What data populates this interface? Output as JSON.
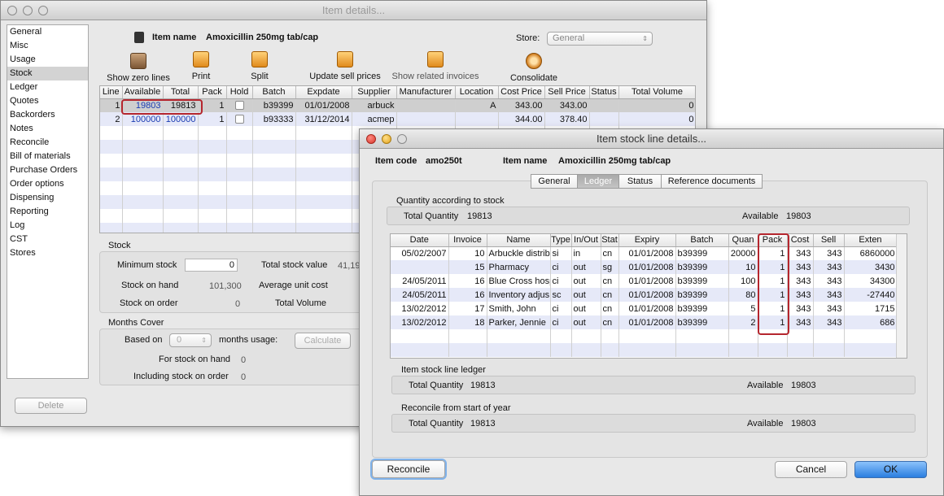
{
  "back_window": {
    "title": "Item details...",
    "sidebar": [
      "General",
      "Misc",
      "Usage",
      "Stock",
      "Ledger",
      "Quotes",
      "Backorders",
      "Notes",
      "Reconcile",
      "Bill of materials",
      "Purchase Orders",
      "Order options",
      "Dispensing",
      "Reporting",
      "Log",
      "CST",
      "Stores"
    ],
    "sidebar_selected": "Stock",
    "delete_label": "Delete",
    "item_name_label": "Item name",
    "item_name": "Amoxicillin 250mg tab/cap",
    "store_label": "Store:",
    "store_value": "General",
    "toolbar": {
      "show_zero": "Show zero lines",
      "print": "Print",
      "split": "Split",
      "update_sell": "Update sell prices",
      "show_related": "Show related invoices",
      "consolidate": "Consolidate"
    },
    "columns": [
      "Line",
      "Available",
      "Total",
      "Pack",
      "Hold",
      "Batch",
      "Expdate",
      "Supplier",
      "Manufacturer",
      "Location",
      "Cost Price",
      "Sell Price",
      "Status",
      "Total Volume"
    ],
    "rows": [
      {
        "line": "1",
        "available": "19803",
        "total": "19813",
        "pack": "1",
        "batch": "b39399",
        "expdate": "01/01/2008",
        "supplier": "arbuck",
        "manufacturer": "",
        "location": "A",
        "cost": "343.00",
        "sell": "343.00",
        "status": "",
        "volume": "0"
      },
      {
        "line": "2",
        "available": "100000",
        "total": "100000",
        "pack": "1",
        "batch": "b93333",
        "expdate": "31/12/2014",
        "supplier": "acmep",
        "manufacturer": "",
        "location": "",
        "cost": "344.00",
        "sell": "378.40",
        "status": "",
        "volume": "0"
      }
    ],
    "stock_section": "Stock",
    "min_stock_label": "Minimum stock",
    "min_stock_value": "0",
    "total_stock_value_label": "Total stock value",
    "total_stock_value": "41,19",
    "stock_on_hand_label": "Stock on hand",
    "stock_on_hand": "101,300",
    "avg_unit_cost_label": "Average unit cost",
    "stock_on_order_label": "Stock on order",
    "stock_on_order": "0",
    "total_volume_label": "Total Volume",
    "months_cover_section": "Months Cover",
    "based_on_label": "Based on",
    "based_on_value": "0",
    "months_usage_label": "months usage:",
    "calculate_label": "Calculate",
    "for_stock_on_hand_label": "For stock on hand",
    "for_stock_on_hand": "0",
    "incl_stock_on_order_label": "Including stock on order",
    "incl_stock_on_order": "0"
  },
  "front_window": {
    "title": "Item stock line details...",
    "item_code_label": "Item code",
    "item_code": "amo250t",
    "item_name_label": "Item name",
    "item_name": "Amoxicillin 250mg tab/cap",
    "tabs": [
      "General",
      "Ledger",
      "Status",
      "Reference documents"
    ],
    "selected_tab": "Ledger",
    "qty_section": "Quantity according to stock",
    "total_quantity_label": "Total Quantity",
    "total_quantity": "19813",
    "available_label": "Available",
    "available": "19803",
    "columns": [
      "Date",
      "Invoice",
      "Name",
      "Type",
      "In/Out",
      "Stat",
      "Expiry",
      "Batch",
      "Quan",
      "Pack",
      "Cost",
      "Sell",
      "Exten"
    ],
    "rows": [
      {
        "date": "05/02/2007",
        "invoice": "10",
        "name": "Arbuckle distrib",
        "type": "si",
        "inout": "in",
        "stat": "cn",
        "expiry": "01/01/2008",
        "batch": "b39399",
        "quan": "20000",
        "pack": "1",
        "cost": "343",
        "sell": "343",
        "exten": "6860000"
      },
      {
        "date": "",
        "invoice": "15",
        "name": "Pharmacy",
        "type": "ci",
        "inout": "out",
        "stat": "sg",
        "expiry": "01/01/2008",
        "batch": "b39399",
        "quan": "10",
        "pack": "1",
        "cost": "343",
        "sell": "343",
        "exten": "3430"
      },
      {
        "date": "24/05/2011",
        "invoice": "16",
        "name": "Blue Cross hosp",
        "type": "ci",
        "inout": "out",
        "stat": "cn",
        "expiry": "01/01/2008",
        "batch": "b39399",
        "quan": "100",
        "pack": "1",
        "cost": "343",
        "sell": "343",
        "exten": "34300"
      },
      {
        "date": "24/05/2011",
        "invoice": "16",
        "name": "Inventory adjus",
        "type": "sc",
        "inout": "out",
        "stat": "cn",
        "expiry": "01/01/2008",
        "batch": "b39399",
        "quan": "80",
        "pack": "1",
        "cost": "343",
        "sell": "343",
        "exten": "-27440"
      },
      {
        "date": "13/02/2012",
        "invoice": "17",
        "name": "Smith, John",
        "type": "ci",
        "inout": "out",
        "stat": "cn",
        "expiry": "01/01/2008",
        "batch": "b39399",
        "quan": "5",
        "pack": "1",
        "cost": "343",
        "sell": "343",
        "exten": "1715"
      },
      {
        "date": "13/02/2012",
        "invoice": "18",
        "name": "Parker, Jennie",
        "type": "ci",
        "inout": "out",
        "stat": "cn",
        "expiry": "01/01/2008",
        "batch": "b39399",
        "quan": "2",
        "pack": "1",
        "cost": "343",
        "sell": "343",
        "exten": "686"
      }
    ],
    "ledger_section": "Item stock line ledger",
    "ledger_total_quantity": "19813",
    "ledger_available": "19803",
    "reconcile_section": "Reconcile from start of year",
    "reconcile_total_quantity": "19813",
    "reconcile_available": "19803",
    "reconcile_button": "Reconcile",
    "cancel_button": "Cancel",
    "ok_button": "OK"
  },
  "colors": {
    "highlight_red": "#b5262e",
    "ok_blue": "#2a7ee0",
    "stripe": "#e6e9f8"
  }
}
